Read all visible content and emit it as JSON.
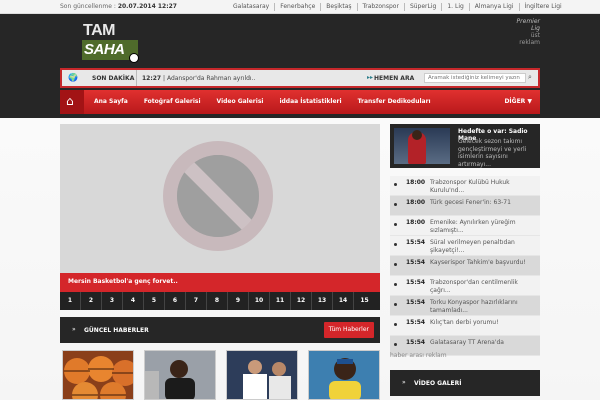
{
  "topbar": {
    "updated_label": "Son güncellenme :",
    "updated_value": "20.07.2014 12:27",
    "links": [
      "Galatasaray",
      "Fenerbahçe",
      "Beşiktaş",
      "Trabzonspor",
      "SüperLig",
      "1. Lig",
      "Almanya Ligi",
      "İngiltere Ligi"
    ]
  },
  "header": {
    "logo_top": "TAM",
    "logo_bottom": "SAHA",
    "ad_text": "üst reklam",
    "ad_overlay": "Premier Lig"
  },
  "newsbar": {
    "label": "SON DAKİKA",
    "ticker_time": "12:27",
    "ticker_text": " | Adanspor'da Rahman ayrıldı..",
    "quick_search_label": "HEMEN ARA",
    "search_placeholder": "Aramak istediğiniz kelimeyi yazın"
  },
  "nav": {
    "items": [
      "Ana Sayfa",
      "Fotoğraf Galerisi",
      "Video Galerisi",
      "iddaa İstatistikleri",
      "Transfer Dedikoduları"
    ],
    "more": "DİĞER ▼"
  },
  "slider": {
    "caption": "Mersin Basketbol'a genç forvet..",
    "pages": [
      "1",
      "2",
      "3",
      "4",
      "5",
      "6",
      "7",
      "8",
      "9",
      "10",
      "11",
      "12",
      "13",
      "14",
      "15"
    ]
  },
  "latest": {
    "title": "GÜNCEL HABERLER",
    "button": "Tüm Haberler"
  },
  "feature": {
    "title": "Hedefte o var: Sadio Mane",
    "desc": "Gelecek sezon takımı gençleştirmeyi ve yerli isimlerin sayısını artırmayı..."
  },
  "news": [
    {
      "time": "18:00",
      "text": "Trabzonspor Kulübü Hukuk Kurulu'nd..."
    },
    {
      "time": "18:00",
      "text": "Türk gecesi Fener'in: 63-71"
    },
    {
      "time": "18:00",
      "text": "Emenike: Aynılırken yüreğim sızlamıştı..."
    },
    {
      "time": "15:54",
      "text": "Süral verilmeyen penaltıdan şikayetçi!..."
    },
    {
      "time": "15:54",
      "text": "Kayserispor Tahkim'e başvurdu!"
    },
    {
      "time": "15:54",
      "text": "Trabzonspor'dan centilmenlik çağrı..."
    },
    {
      "time": "15:54",
      "text": "Torku Konyaspor hazırlıklarını tamamladı..."
    },
    {
      "time": "15:54",
      "text": "Kılıç'tan derbi yorumu!"
    },
    {
      "time": "15:54",
      "text": "Galatasaray TT Arena'da"
    }
  ],
  "right_ad": "haber arası reklam",
  "video_gallery": {
    "title": "VİDEO GALERİ"
  },
  "colors": {
    "accent": "#d4262a",
    "dark": "#262626",
    "logo_green": "#4f6b2b"
  }
}
